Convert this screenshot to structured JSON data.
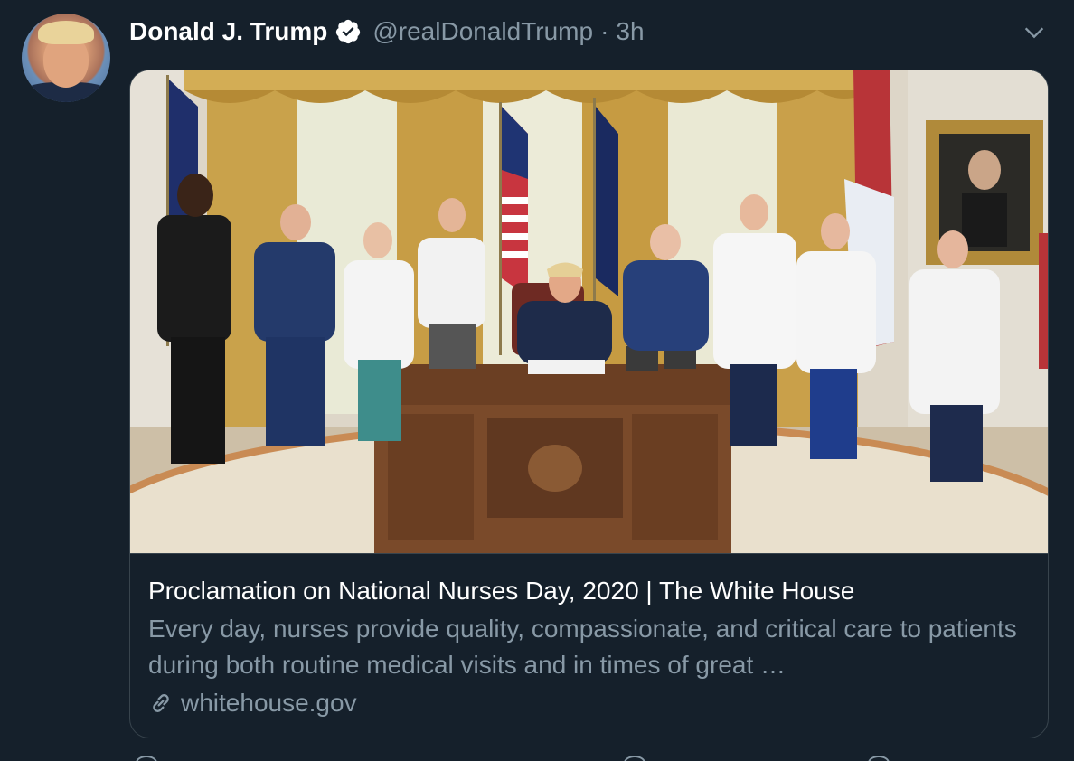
{
  "author": {
    "name": "Donald J. Trump",
    "handle": "@realDonaldTrump",
    "separator": "·",
    "time": "3h"
  },
  "card": {
    "title": "Proclamation on National Nurses Day, 2020 | The White House",
    "description": "Every day, nurses provide quality, compassionate, and critical care to patients during both routine medical visits and in times of great …",
    "domain": "whitehouse.gov"
  },
  "icons": {
    "verified": "verified-badge-icon",
    "caret": "chevron-down-icon",
    "link": "link-icon"
  },
  "colors": {
    "background": "#15202b",
    "primary_text": "#ffffff",
    "secondary_text": "#8899a6",
    "border": "#38444d"
  }
}
